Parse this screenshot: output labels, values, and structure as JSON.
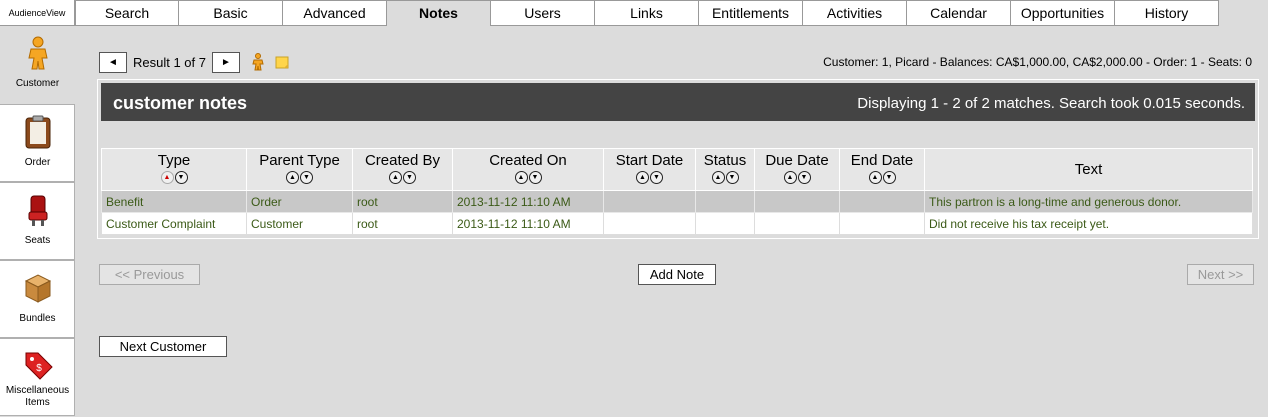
{
  "brand": "AudienceView",
  "tabs": [
    {
      "label": "Search"
    },
    {
      "label": "Basic"
    },
    {
      "label": "Advanced"
    },
    {
      "label": "Notes",
      "active": true
    },
    {
      "label": "Users"
    },
    {
      "label": "Links"
    },
    {
      "label": "Entitlements"
    },
    {
      "label": "Activities"
    },
    {
      "label": "Calendar"
    },
    {
      "label": "Opportunities"
    },
    {
      "label": "History"
    }
  ],
  "rail": [
    {
      "label": "Customer",
      "icon": "person-icon"
    },
    {
      "label": "Order",
      "icon": "clipboard-icon"
    },
    {
      "label": "Seats",
      "icon": "seat-icon"
    },
    {
      "label": "Bundles",
      "icon": "box-icon"
    },
    {
      "label": "Miscellaneous Items",
      "icon": "price-tag-icon"
    }
  ],
  "nav": {
    "prev_symbol": "◄",
    "next_symbol": "►",
    "result_text": "Result 1 of 7"
  },
  "customer_info": "Customer: 1, Picard - Balances: CA$1,000.00, CA$2,000.00 - Order: 1 - Seats: 0",
  "panel": {
    "title": "customer notes",
    "status": "Displaying 1 - 2 of 2 matches. Search took 0.015 seconds."
  },
  "table": {
    "columns": [
      "Type",
      "Parent Type",
      "Created By",
      "Created On",
      "Start Date",
      "Status",
      "Due Date",
      "End Date",
      "Text"
    ],
    "rows": [
      [
        "Benefit",
        "Order",
        "root",
        "2013-11-12 11:10 AM",
        "",
        "",
        "",
        "",
        "This partron is a long-time and generous donor."
      ],
      [
        "Customer Complaint",
        "Customer",
        "root",
        "2013-11-12 11:10 AM",
        "",
        "",
        "",
        "",
        "Did not receive his tax receipt yet."
      ]
    ],
    "sort_indicator": "1"
  },
  "buttons": {
    "previous": "<< Previous",
    "add_note": "Add Note",
    "next": "Next >>",
    "next_customer": "Next Customer"
  }
}
